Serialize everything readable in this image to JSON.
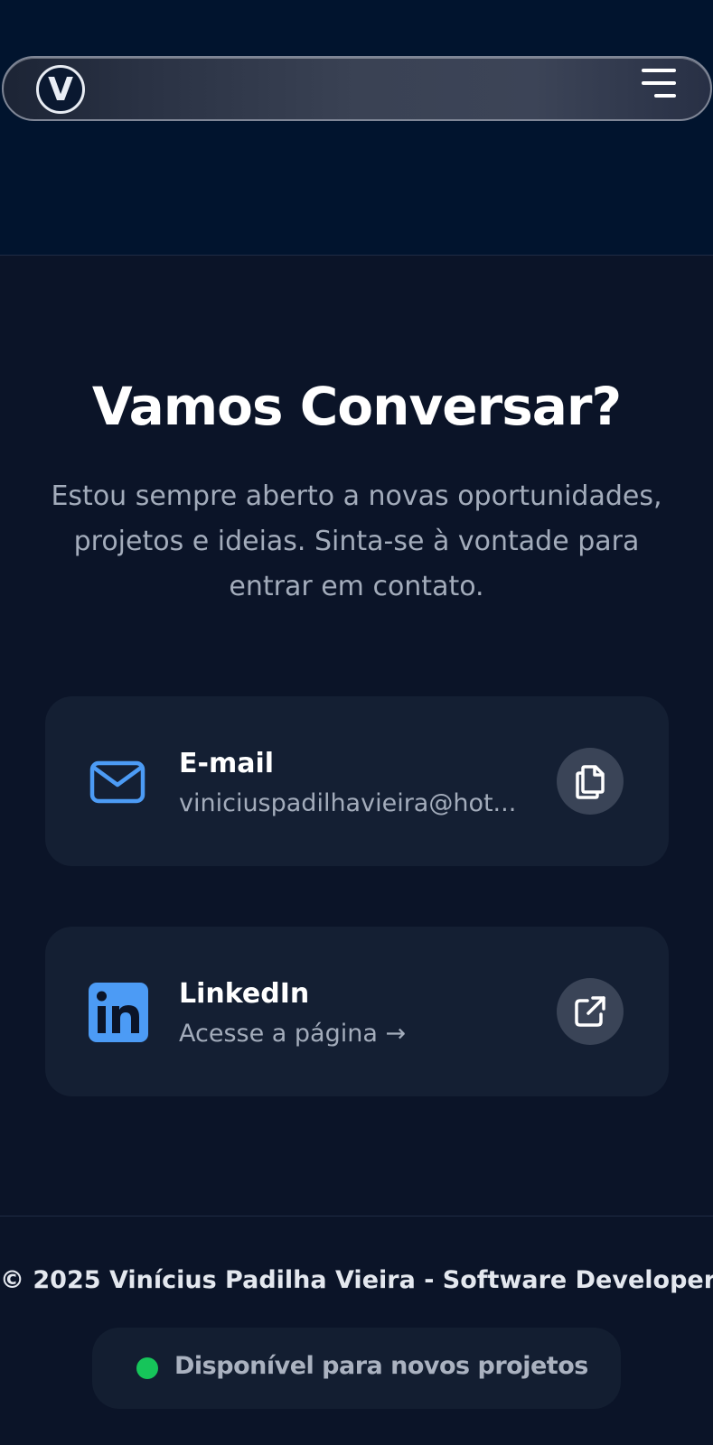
{
  "header": {
    "logo_letter": "V",
    "menu_icon": "hamburger-menu-icon"
  },
  "contact": {
    "title": "Vamos Conversar?",
    "subtitle": "Estou sempre aberto a novas oportunidades, projetos e ideias. Sinta-se à vontade para entrar em contato.",
    "email_card": {
      "title": "E-mail",
      "value": "viniciuspadilhavieira@hot...",
      "icon": "mail-icon",
      "action_icon": "copy-icon"
    },
    "linkedin_card": {
      "title": "LinkedIn",
      "value": "Acesse a página →",
      "icon": "linkedin-icon",
      "action_icon": "external-link-icon"
    }
  },
  "footer": {
    "copyright": "© 2025 Vinícius Padilha Vieira - Software Developer",
    "status": "Disponível para novos projetos",
    "status_color": "#16c55a"
  },
  "colors": {
    "background": "#0b1428",
    "card": "#141f33",
    "accent_blue": "#4c9bf5",
    "muted_text": "#a3acbb"
  }
}
